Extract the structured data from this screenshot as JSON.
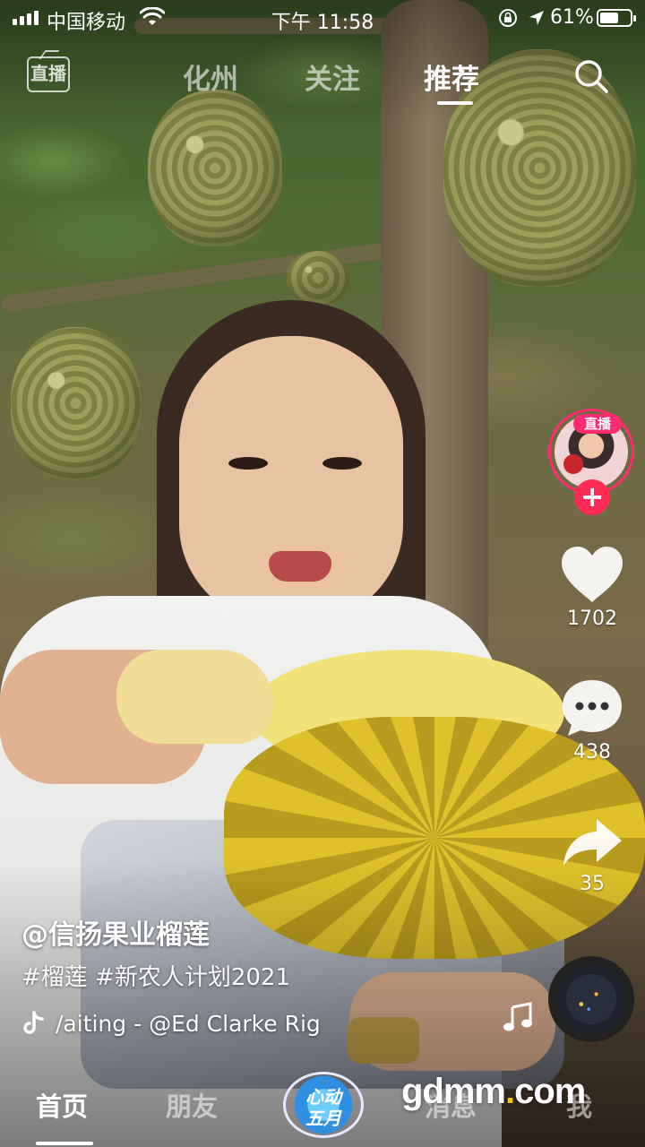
{
  "status_bar": {
    "carrier": "中国移动",
    "time": "下午 11:58",
    "battery_percent": "61%",
    "battery_level": 0.61
  },
  "top_nav": {
    "live_icon_label": "直播",
    "tabs": [
      {
        "label": "化州",
        "active": false
      },
      {
        "label": "关注",
        "active": false
      },
      {
        "label": "推荐",
        "active": true
      }
    ],
    "search_icon": "search-icon"
  },
  "side_rail": {
    "avatar_live_badge": "直播",
    "follow_icon": "+",
    "likes": "1702",
    "comments": "438",
    "shares": "35"
  },
  "caption": {
    "author": "@信扬果业榴莲",
    "hashtags": "#榴莲 #新农人计划2021",
    "music": "/aiting - @Ed Clarke    Rig"
  },
  "bottom_nav": {
    "items": [
      {
        "label": "首页",
        "active": true
      },
      {
        "label": "朋友",
        "active": false
      },
      {
        "label": "消息",
        "active": false
      },
      {
        "label": "我",
        "active": false
      }
    ],
    "center_badge_line1": "心动",
    "center_badge_line2": "五月"
  },
  "watermark": {
    "pre": "gdmm",
    "dot": ".",
    "post": "com"
  }
}
